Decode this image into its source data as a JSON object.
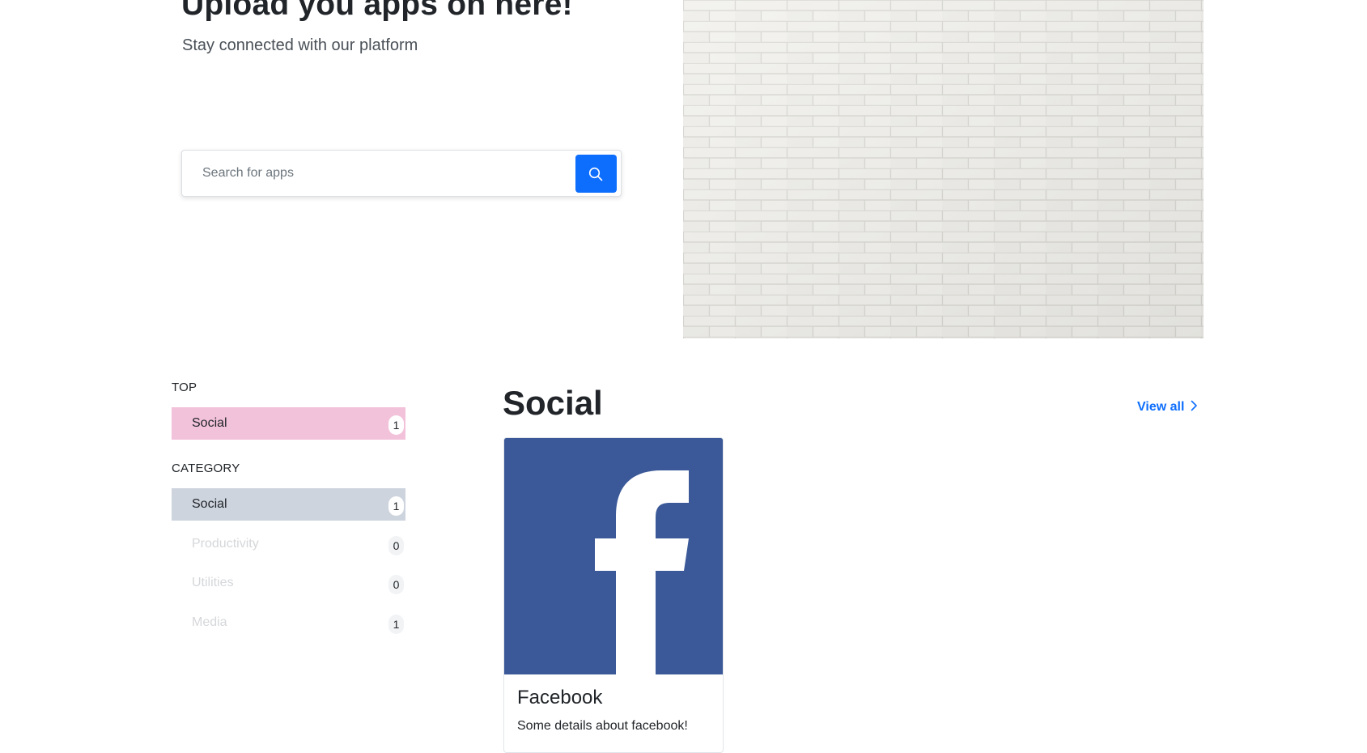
{
  "hero": {
    "title": "Upload you apps on here!",
    "subtitle": "Stay connected with our platform"
  },
  "search": {
    "placeholder": "Search for apps",
    "button_icon": "search-icon",
    "button_color": "#0d6efd"
  },
  "sidebar": {
    "top_heading": "TOP",
    "top_items": [
      {
        "label": "Social",
        "count": "1"
      }
    ],
    "category_heading": "CATEGORY",
    "category_items": [
      {
        "label": "Social",
        "count": "1"
      },
      {
        "label": "Productivity",
        "count": "0"
      },
      {
        "label": "Utilities",
        "count": "0"
      },
      {
        "label": "Media",
        "count": "1"
      }
    ]
  },
  "section": {
    "title": "Social",
    "view_all_label": "View all",
    "view_all_icon": "chevron-right-icon"
  },
  "apps": [
    {
      "name": "Facebook",
      "description": "Some details about facebook!",
      "icon": "facebook-logo",
      "brand_color": "#3b5998"
    }
  ],
  "colors": {
    "accent": "#0d6efd",
    "top_active_bg": "#f2c1da",
    "category_active_bg": "#ced4de"
  }
}
